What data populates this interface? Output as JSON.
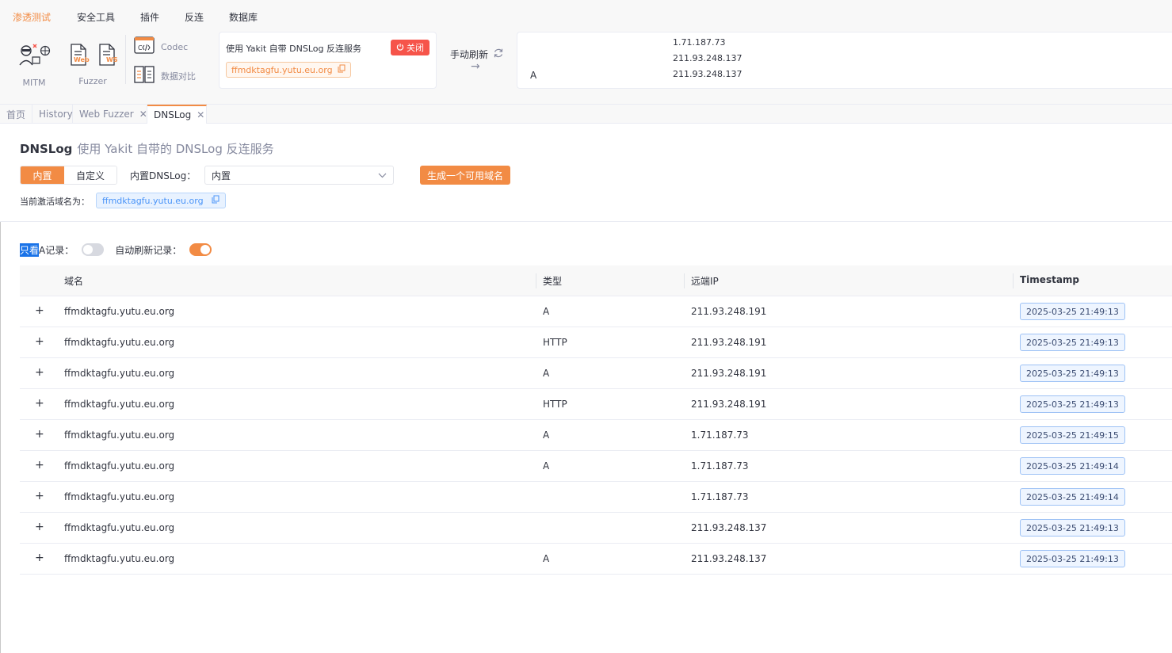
{
  "menu": [
    "渗透测试",
    "安全工具",
    "插件",
    "反连",
    "数据库"
  ],
  "ribbon": {
    "mitm_label": "MITM",
    "fuzzer_label": "Fuzzer",
    "web_icon_text": "Web",
    "ws_icon_text": "WS",
    "codec_label": "Codec",
    "compare_label": "数据对比",
    "dnslog_card": {
      "title": "使用 Yakit 自带 DNSLog 反连服务",
      "close_label": "关闭",
      "domain": "ffmdktagfu.yutu.eu.org"
    },
    "manual_refresh": "手动刷新",
    "records": {
      "ips": [
        "1.71.187.73",
        "211.93.248.137",
        "211.93.248.137"
      ],
      "type": "A"
    }
  },
  "tabs": [
    {
      "label": "首页",
      "closable": false
    },
    {
      "label": "History",
      "closable": false
    },
    {
      "label": "Web Fuzzer",
      "closable": true
    },
    {
      "label": "DNSLog",
      "closable": true,
      "active": true
    }
  ],
  "page": {
    "title": "DNSLog",
    "subtitle": "使用 Yakit 自带的 DNSLog 反连服务",
    "segment": {
      "builtin": "内置",
      "custom": "自定义"
    },
    "builtin_label": "内置DNSLog：",
    "builtin_value": "内置",
    "generate_button": "生成一个可用域名",
    "active_domain_label": "当前激活域名为：",
    "active_domain": "ffmdktagfu.yutu.eu.org",
    "only_a_prefix": "只看",
    "only_a_rest": "A记录：",
    "auto_refresh_label": "自动刷新记录：",
    "only_a_on": false,
    "auto_refresh_on": true
  },
  "table": {
    "columns": [
      "域名",
      "类型",
      "远端IP",
      "Timestamp"
    ],
    "rows": [
      {
        "domain": "ffmdktagfu.yutu.eu.org",
        "type": "A",
        "ip": "211.93.248.191",
        "ts": "2025-03-25 21:49:13"
      },
      {
        "domain": "ffmdktagfu.yutu.eu.org",
        "type": "HTTP",
        "ip": "211.93.248.191",
        "ts": "2025-03-25 21:49:13"
      },
      {
        "domain": "ffmdktagfu.yutu.eu.org",
        "type": "A",
        "ip": "211.93.248.191",
        "ts": "2025-03-25 21:49:13"
      },
      {
        "domain": "ffmdktagfu.yutu.eu.org",
        "type": "HTTP",
        "ip": "211.93.248.191",
        "ts": "2025-03-25 21:49:13"
      },
      {
        "domain": "ffmdktagfu.yutu.eu.org",
        "type": "A",
        "ip": "1.71.187.73",
        "ts": "2025-03-25 21:49:15"
      },
      {
        "domain": "ffmdktagfu.yutu.eu.org",
        "type": "A",
        "ip": "1.71.187.73",
        "ts": "2025-03-25 21:49:14"
      },
      {
        "domain": "ffmdktagfu.yutu.eu.org",
        "type": "",
        "ip": "1.71.187.73",
        "ts": "2025-03-25 21:49:14"
      },
      {
        "domain": "ffmdktagfu.yutu.eu.org",
        "type": "",
        "ip": "211.93.248.137",
        "ts": "2025-03-25 21:49:13"
      },
      {
        "domain": "ffmdktagfu.yutu.eu.org",
        "type": "A",
        "ip": "211.93.248.137",
        "ts": "2025-03-25 21:49:13"
      }
    ]
  },
  "colors": {
    "accent": "#f28b44",
    "danger": "#f6544a",
    "link": "#4a94f8",
    "text": "#31343f",
    "muted": "#85899e"
  }
}
